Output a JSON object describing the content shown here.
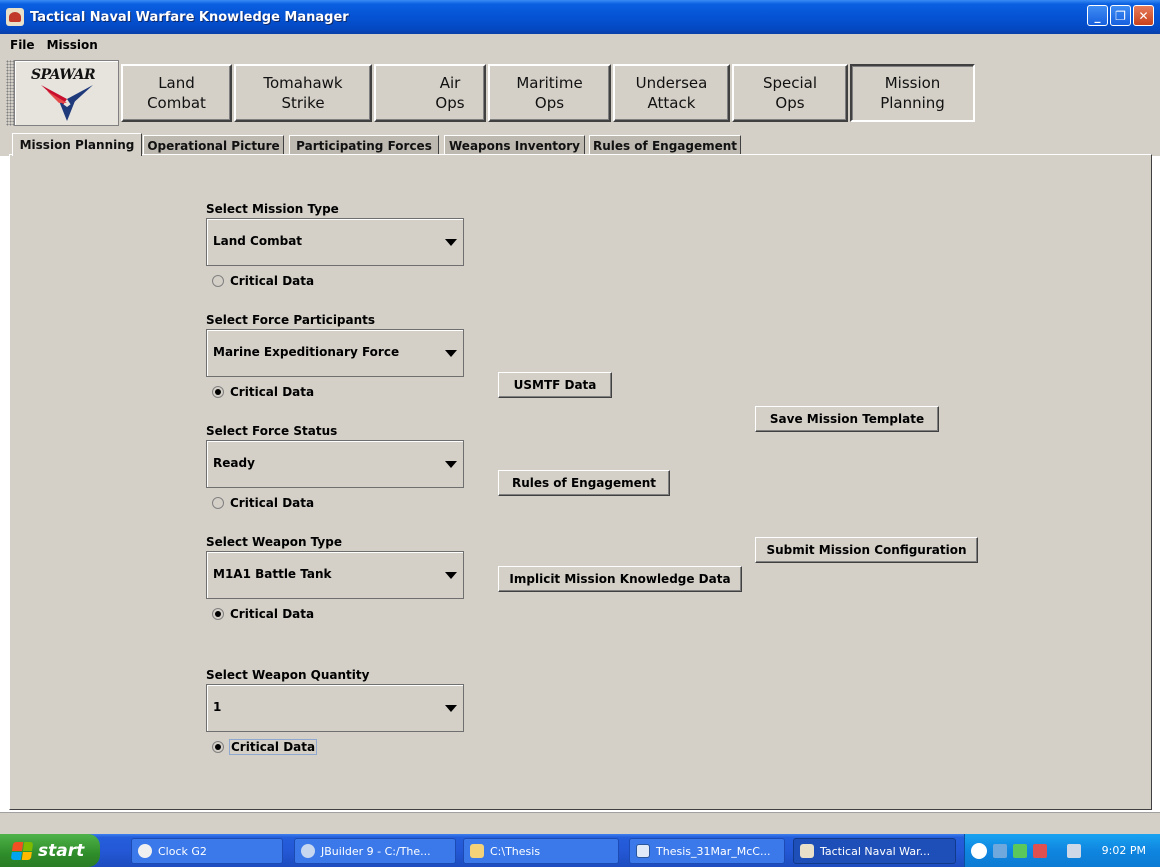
{
  "window": {
    "title": "Tactical Naval Warfare Knowledge Manager",
    "minimize": "_",
    "restore": "❐",
    "close": "✕"
  },
  "menu": [
    "File",
    "Mission"
  ],
  "toolbar": {
    "logo_text": "SPAWAR",
    "buttons": [
      "Land\nCombat",
      "Tomahawk\nStrike",
      "Air\nOps",
      "Maritime\nOps",
      "Undersea\nAttack",
      "Special\nOps",
      "Mission\nPlanning"
    ]
  },
  "tabs": [
    "Mission Planning",
    "Operational Picture",
    "Participating Forces",
    "Weapons Inventory",
    "Rules of Engagement"
  ],
  "form": {
    "mission_type": {
      "label": "Select Mission Type",
      "value": "Land Combat",
      "critical_label": "Critical Data",
      "critical": false
    },
    "force_participants": {
      "label": "Select Force Participants",
      "value": "Marine Expeditionary Force",
      "critical_label": "Critical Data",
      "critical": true
    },
    "force_status": {
      "label": "Select Force Status",
      "value": "Ready",
      "critical_label": "Critical Data",
      "critical": false
    },
    "weapon_type": {
      "label": "Select Weapon Type",
      "value": "M1A1 Battle Tank",
      "critical_label": "Critical Data",
      "critical": true
    },
    "weapon_quantity": {
      "label": "Select Weapon Quantity",
      "value": "1",
      "critical_label": "Critical Data",
      "critical": true
    }
  },
  "actions": {
    "usmtf": "USMTF Data",
    "roe": "Rules of Engagement",
    "implicit": "Implicit Mission Knowledge Data",
    "save": "Save Mission Template",
    "submit": "Submit Mission Configuration"
  },
  "taskbar": {
    "start": "start",
    "tasks": [
      "Clock G2",
      "JBuilder 9 - C:/The...",
      "C:\\Thesis",
      "Thesis_31Mar_McC...",
      "Tactical Naval War..."
    ],
    "clock": "9:02 PM"
  },
  "colors": {
    "titlebar": "#0553d4",
    "chrome": "#d4d0c8",
    "taskbar": "#245edb",
    "start": "#2f8d2a"
  }
}
